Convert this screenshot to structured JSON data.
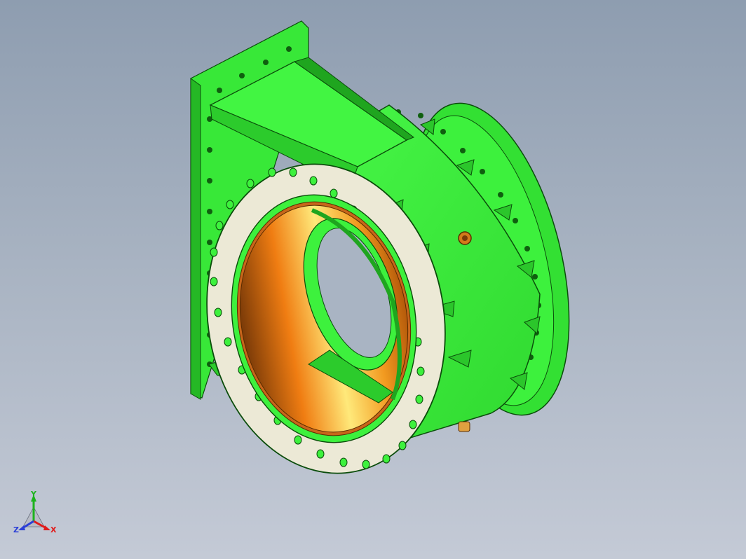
{
  "colors": {
    "body_green": "#3df13d",
    "dark_green": "#1fa51f",
    "flange_face": "#ece9d6",
    "copper": "#f08a14",
    "background_top": "#8e9db0",
    "background_bottom": "#c4cad6"
  },
  "triad": {
    "icon": "coordinate-triad-icon",
    "axis_y": "Y",
    "axis_z": "Z",
    "axis_x": "X",
    "color_y": "#1db31d",
    "color_z": "#2b3fd6",
    "color_x": "#e01c1c"
  },
  "model": {
    "icon": "valve-assembly-3d-model"
  }
}
